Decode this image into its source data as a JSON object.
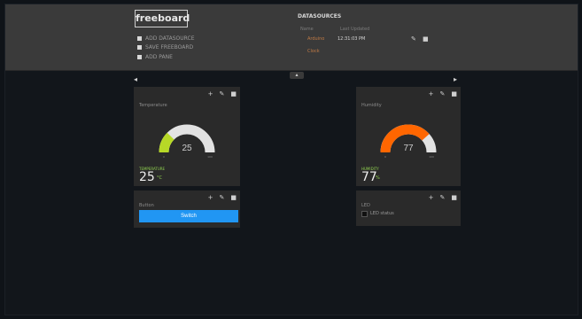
{
  "header": {
    "logo": "freeboard",
    "nav": [
      "ADD DATASOURCE",
      "SAVE FREEBOARD",
      "ADD PANE"
    ],
    "datasources_title": "DATASOURCES",
    "columns": [
      "Name",
      "Last Updated"
    ],
    "datasources": [
      {
        "name": "Arduino",
        "last_updated": "12:31:03 PM"
      },
      {
        "name": "Clock",
        "last_updated": ""
      }
    ]
  },
  "tab_label": "▴",
  "panes": [
    {
      "title": "Temperature",
      "gauge": {
        "value": 25,
        "min": 0,
        "max": 100,
        "fill_fraction": 0.25,
        "color": "#b7d827",
        "track": "#e2e2e2",
        "min_label": "0",
        "max_label": "100"
      },
      "value_label": "TEMPERATURE",
      "value": "25",
      "unit": "°C"
    },
    {
      "title": "Humidity",
      "gauge": {
        "value": 77,
        "min": 0,
        "max": 100,
        "fill_fraction": 0.77,
        "color": "#ff6600",
        "track": "#e2e2e2",
        "min_label": "0",
        "max_label": "100"
      },
      "value_label": "HUMIDITY",
      "value": "77",
      "unit": "%"
    },
    {
      "title": "Button",
      "button_label": "Switch"
    },
    {
      "title": "LED",
      "led_label": "LED status"
    }
  ]
}
